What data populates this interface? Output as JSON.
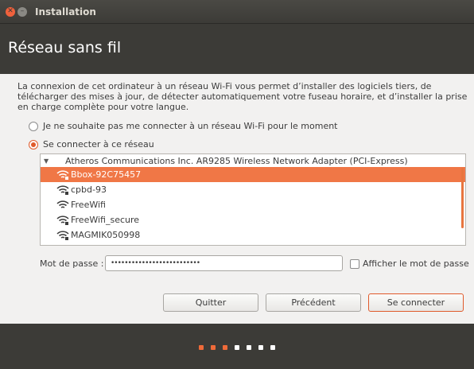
{
  "window": {
    "title": "Installation"
  },
  "header": {
    "title": "Réseau sans fil"
  },
  "intro": "La connexion de cet ordinateur à un réseau Wi-Fi vous permet d’installer des logiciels tiers, de télécharger des mises à jour, de détecter automatiquement votre fuseau horaire, et d’installer la prise en charge complète pour votre langue.",
  "options": {
    "no_wifi": "Je ne souhaite pas me connecter à un réseau Wi-Fi pour le moment",
    "connect": "Se connecter à ce réseau",
    "selected": "connect"
  },
  "adapter": "Atheros Communications Inc. AR9285 Wireless Network Adapter (PCI-Express)",
  "networks": [
    {
      "ssid": "Bbox-92C75457",
      "secured": true,
      "selected": true
    },
    {
      "ssid": "cpbd-93",
      "secured": true,
      "selected": false
    },
    {
      "ssid": "FreeWifi",
      "secured": false,
      "selected": false
    },
    {
      "ssid": "FreeWifi_secure",
      "secured": true,
      "selected": false
    },
    {
      "ssid": "MAGMIK050998",
      "secured": true,
      "selected": false
    }
  ],
  "password": {
    "label": "Mot de passe :",
    "value": "••••••••••••••••••••••••••",
    "show_label": "Afficher le mot de passe",
    "show_checked": false
  },
  "buttons": {
    "quit": "Quitter",
    "back": "Précédent",
    "connect": "Se connecter"
  },
  "progress": {
    "total_steps": 7,
    "completed_steps": 3
  },
  "colors": {
    "accent": "#ef6a39",
    "header_bg": "#3c3b37",
    "content_bg": "#f2f1f0"
  }
}
